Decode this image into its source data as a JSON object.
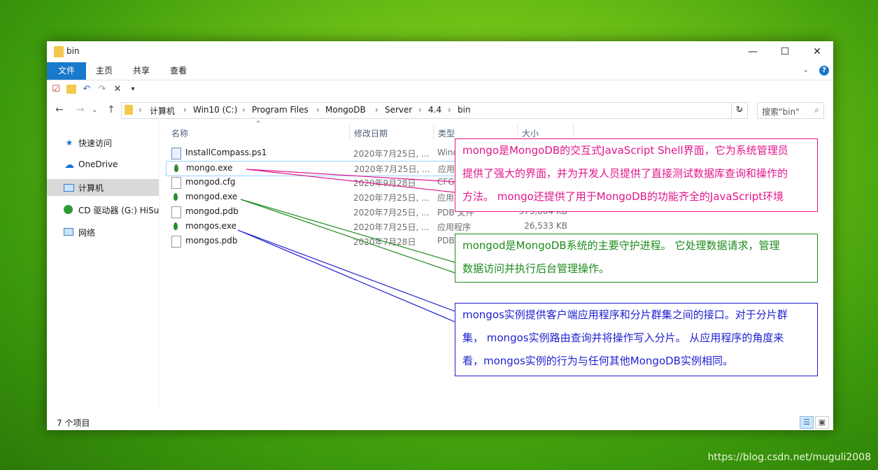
{
  "window": {
    "title": "bin"
  },
  "ribbon": {
    "tabs": [
      "文件",
      "主页",
      "共享",
      "查看"
    ]
  },
  "address": {
    "crumbs": [
      "计算机",
      "Win10 (C:)",
      "Program Files",
      "MongoDB",
      "Server",
      "4.4",
      "bin"
    ],
    "search_placeholder": "搜索\"bin\""
  },
  "sidebar": {
    "items": [
      {
        "label": "快速访问",
        "icon": "star-icon"
      },
      {
        "label": "OneDrive",
        "icon": "cloud-icon"
      },
      {
        "label": "计算机",
        "icon": "computer-icon"
      },
      {
        "label": "CD 驱动器 (G:) HiSu",
        "icon": "cd-drive-icon"
      },
      {
        "label": "网络",
        "icon": "network-icon"
      }
    ]
  },
  "columns": {
    "name": "名称",
    "date": "修改日期",
    "type": "类型",
    "size": "大小"
  },
  "files": [
    {
      "name": "InstallCompass.ps1",
      "date": "2020年7月25日, ...",
      "type": "Wind",
      "size": ""
    },
    {
      "name": "mongo.exe",
      "date": "2020年7月25日, ...",
      "type": "应用",
      "size": ""
    },
    {
      "name": "mongod.cfg",
      "date": "2020年9月28日",
      "type": "CFG",
      "size": ""
    },
    {
      "name": "mongod.exe",
      "date": "2020年7月25日, ...",
      "type": "应用",
      "size": ""
    },
    {
      "name": "mongod.pdb",
      "date": "2020年7月25日, ...",
      "type": "PDB 文件",
      "size": "375,804 KB"
    },
    {
      "name": "mongos.exe",
      "date": "2020年7月25日, ...",
      "type": "应用程序",
      "size": "26,533 KB"
    },
    {
      "name": "mongos.pdb",
      "date": "2020年7月28日",
      "type": "PDB",
      "size": ""
    }
  ],
  "status": {
    "count": "7 个项目"
  },
  "callouts": {
    "mongo": [
      "mongo是MongoDB的交互式JavaScript Shell界面，它为系统管理员",
      "提供了强大的界面，并为开发人员提供了直接测试数据库查询和操作的",
      "方法。 mongo还提供了用于MongoDB的功能齐全的JavaScript环境"
    ],
    "mongod": [
      "mongod是MongoDB系统的主要守护进程。 它处理数据请求，管理",
      "数据访问并执行后台管理操作。"
    ],
    "mongos": [
      "mongos实例提供客户端应用程序和分片群集之间的接口。对于分片群",
      "集， mongos实例路由查询并将操作写入分片。 从应用程序的角度来",
      "看，mongos实例的行为与任何其他MongoDB实例相同。"
    ]
  },
  "colors": {
    "pink": "#e3168c",
    "green": "#1d8b1d",
    "blue": "#1f1fd0",
    "ribbon_blue": "#1979ca"
  },
  "watermark": "https://blog.csdn.net/muguli2008"
}
